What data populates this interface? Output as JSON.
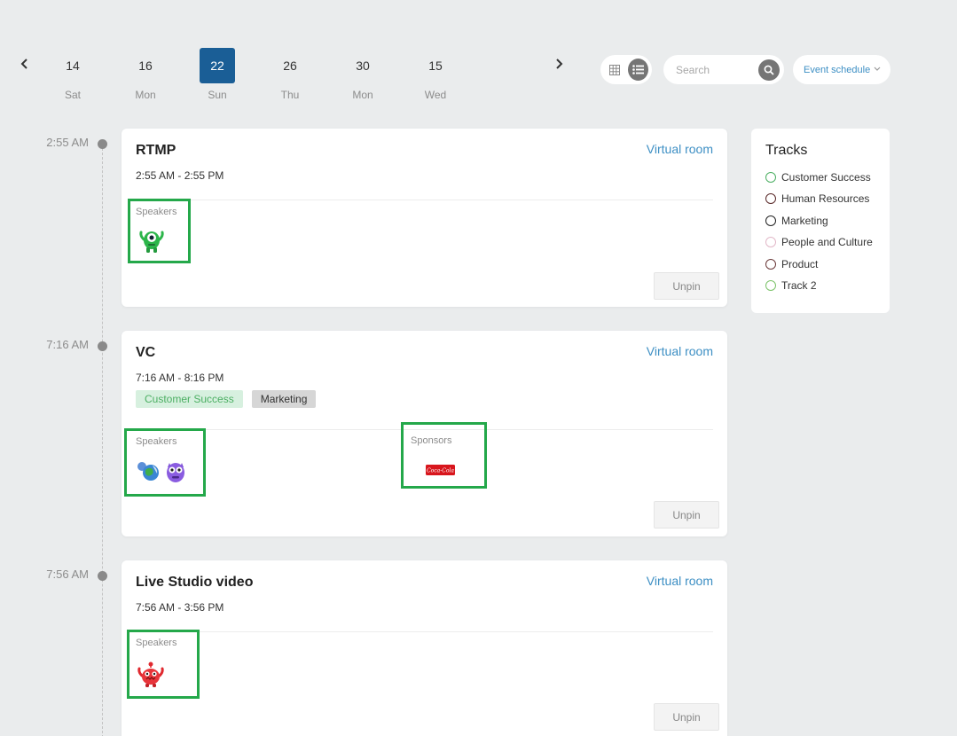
{
  "dates": [
    {
      "num": "14",
      "day": "Sat"
    },
    {
      "num": "16",
      "day": "Mon"
    },
    {
      "num": "22",
      "day": "Sun",
      "active": true
    },
    {
      "num": "26",
      "day": "Thu"
    },
    {
      "num": "30",
      "day": "Mon"
    },
    {
      "num": "15",
      "day": "Wed"
    }
  ],
  "nav": {
    "prev_icon": "chevron-left-icon",
    "next_icon": "chevron-right-icon"
  },
  "toolbar": {
    "view_modes": [
      "grid-view",
      "list-view"
    ],
    "active_view": "list-view",
    "search_placeholder": "Search",
    "search_value": "",
    "schedule_select": "Event schedule"
  },
  "events": [
    {
      "time_label": "2:55 AM",
      "title": "RTMP",
      "room": "Virtual room",
      "time_range": "2:55 AM - 2:55 PM",
      "tags": [],
      "speakers_label": "Speakers",
      "speakers": [
        "green-monster-avatar"
      ],
      "unpin_label": "Unpin"
    },
    {
      "time_label": "7:16 AM",
      "title": "VC",
      "room": "Virtual room",
      "time_range": "7:16 AM - 8:16 PM",
      "tags": [
        {
          "label": "Customer Success",
          "bg": "#d7f0df",
          "color": "#4caf63"
        },
        {
          "label": "Marketing",
          "bg": "#d6d6d6",
          "color": "#333333"
        }
      ],
      "speakers_label": "Speakers",
      "speakers": [
        "earth-avatar",
        "purple-monster-avatar"
      ],
      "sponsors_label": "Sponsors",
      "sponsors": [
        "coca-cola-logo"
      ],
      "sponsor_logo_text": "Coca-Cola",
      "unpin_label": "Unpin"
    },
    {
      "time_label": "7:56 AM",
      "title": "Live Studio video",
      "room": "Virtual room",
      "time_range": "7:56 AM - 3:56 PM",
      "tags": [],
      "speakers_label": "Speakers",
      "speakers": [
        "red-monster-avatar"
      ],
      "unpin_label": "Unpin"
    }
  ],
  "tracks": {
    "title": "Tracks",
    "items": [
      {
        "label": "Customer Success",
        "color": "#4caf63"
      },
      {
        "label": "Human Resources",
        "color": "#5a2a2a"
      },
      {
        "label": "Marketing",
        "color": "#222222"
      },
      {
        "label": "People and Culture",
        "color": "#e2b8c8"
      },
      {
        "label": "Product",
        "color": "#6b3a3a"
      },
      {
        "label": "Track 2",
        "color": "#7cc36a"
      }
    ]
  },
  "colors": {
    "accent": "#1a5e96",
    "link": "#3d8fc4",
    "highlight": "#24a84a",
    "background": "#eaeced"
  }
}
